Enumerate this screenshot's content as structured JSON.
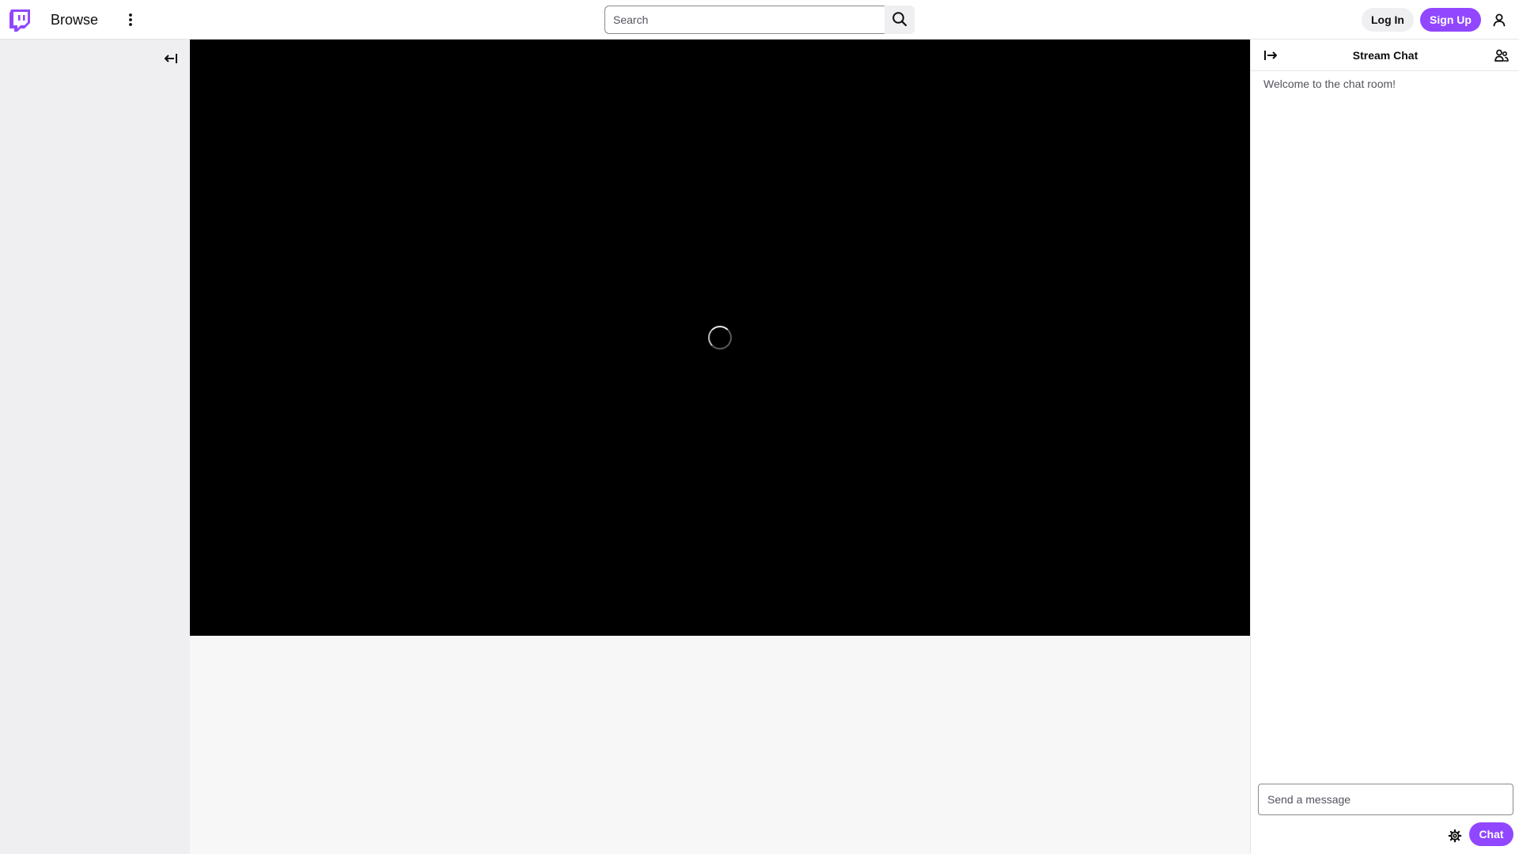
{
  "nav": {
    "browse_label": "Browse",
    "search": {
      "placeholder": "Search",
      "value": ""
    },
    "login_label": "Log In",
    "signup_label": "Sign Up"
  },
  "icons": {
    "logo": "twitch-glitch-icon",
    "more": "kebab-menu-icon",
    "search": "search-icon",
    "user": "user-icon",
    "sidebar_collapse": "arrow-collapse-left-icon",
    "chat_collapse": "arrow-collapse-right-icon",
    "chat_users": "community-icon",
    "chat_settings": "gear-icon"
  },
  "player": {
    "state": "loading"
  },
  "chat": {
    "title": "Stream Chat",
    "welcome": "Welcome to the chat room!",
    "input": {
      "placeholder": "Send a message",
      "value": ""
    },
    "send_label": "Chat"
  },
  "colors": {
    "brand": "#9147ff",
    "sidebar_bg": "#efeff1",
    "player_bg": "#000000",
    "content_bg": "#f7f7f8"
  }
}
